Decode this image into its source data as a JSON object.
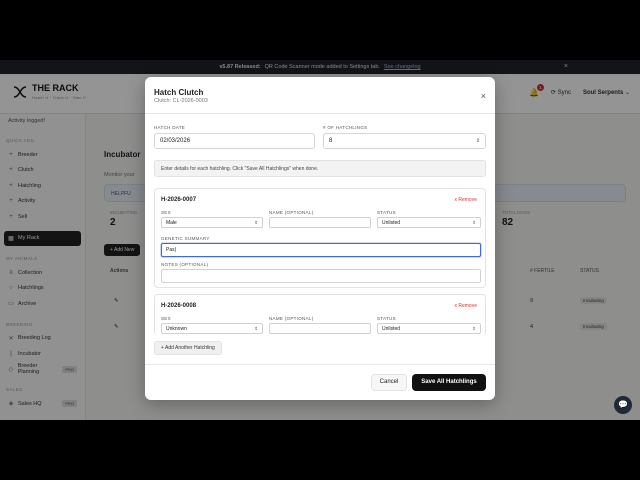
{
  "banner": {
    "version": "v5.87 Released:",
    "message": "QR Code Scanner mode added to Settings tab.",
    "link": "See changelog",
    "close": "×"
  },
  "brand": {
    "name": "THE RACK",
    "tagline": "Hatch It · Track It · Own It"
  },
  "topbar": {
    "notifications": "1",
    "sync": "Sync",
    "org": "Soul Serpents"
  },
  "sidebar": {
    "activity": "Activity logged!",
    "quick_add_label": "QUICK ADD",
    "quick_add": [
      "Breeder",
      "Clutch",
      "Hatchling",
      "Activity",
      "Sell"
    ],
    "my_rack": "My Rack",
    "my_animals_label": "MY ANIMALS",
    "my_animals": [
      "Collection",
      "Hatchlings",
      "Archive"
    ],
    "breeding_label": "BREEDING",
    "breeding": [
      "Breeding Log",
      "Incubator",
      "Breeder Planning"
    ],
    "pro": "PRO",
    "sales_label": "SALES",
    "sales": [
      "Sales HQ"
    ]
  },
  "page": {
    "title": "Incubator",
    "subtitle": "Monitor your",
    "help": "HELPFU",
    "stats": [
      {
        "label": "INCUBATING",
        "value": "2"
      },
      {
        "label": "TOTAL EGGS",
        "value": "82"
      }
    ],
    "add_new": "+ Add New",
    "table_actions": "Actions",
    "table_fertile": "# FERTILE",
    "table_status": "STATUS",
    "rows": [
      {
        "fertile": "9",
        "status": "Incubating"
      },
      {
        "fertile": "4",
        "status": "Incubating"
      }
    ]
  },
  "modal": {
    "title": "Hatch Clutch",
    "subtitle": "Clutch: CL-2026-0003",
    "close": "×",
    "hatch_date_label": "HATCH DATE",
    "hatch_date": "02/03/2026",
    "num_label": "# OF HATCHLINGS",
    "num_value": "8",
    "info": "Enter details for each hatchling. Click \"Save All Hatchlings\" when done.",
    "sex_label": "SEX",
    "name_label": "NAME (OPTIONAL)",
    "status_label": "STATUS",
    "genetic_label": "GENETIC SUMMARY",
    "notes_label": "NOTES (OPTIONAL)",
    "remove": "x Remove",
    "hatchlings": [
      {
        "id": "H-2026-0007",
        "sex": "Male",
        "name": "",
        "status": "Unlisted",
        "genetic": "Pas",
        "notes": ""
      },
      {
        "id": "H-2026-0008",
        "sex": "Unknown",
        "name": "",
        "status": "Unlisted"
      }
    ],
    "add_another": "+ Add Another Hatchling",
    "cancel": "Cancel",
    "save_all": "Save All Hatchlings"
  }
}
